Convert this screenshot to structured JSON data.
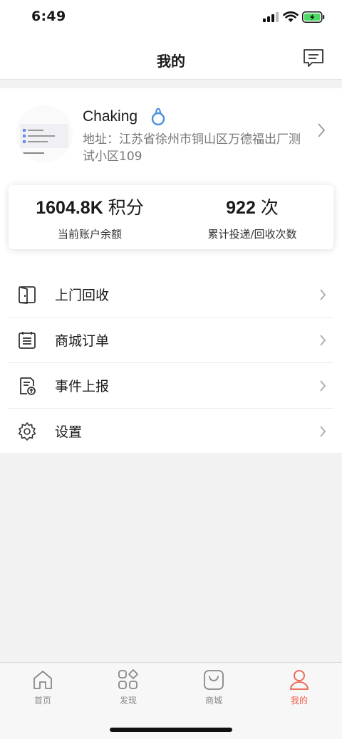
{
  "status_bar": {
    "time": "6:49"
  },
  "nav": {
    "title": "我的"
  },
  "profile": {
    "username": "Chaking",
    "address": "地址：江苏省徐州市铜山区万德福出厂测试小区109"
  },
  "stats": [
    {
      "value": "1604.8K",
      "unit": "积分",
      "label": "当前账户余额"
    },
    {
      "value": "922",
      "unit": "次",
      "label": "累计投递/回收次数"
    }
  ],
  "menu": [
    {
      "label": "上门回收",
      "icon": "door-icon"
    },
    {
      "label": "商城订单",
      "icon": "order-list-icon"
    },
    {
      "label": "事件上报",
      "icon": "report-icon"
    },
    {
      "label": "设置",
      "icon": "gear-icon"
    }
  ],
  "tabs": [
    {
      "label": "首页",
      "icon": "home-icon"
    },
    {
      "label": "发现",
      "icon": "discover-icon"
    },
    {
      "label": "商城",
      "icon": "shop-icon"
    },
    {
      "label": "我的",
      "icon": "user-icon",
      "active": true
    }
  ],
  "colors": {
    "accent": "#ec5f4c",
    "ring_blue": "#4a90d9",
    "battery_green": "#4cd964"
  }
}
